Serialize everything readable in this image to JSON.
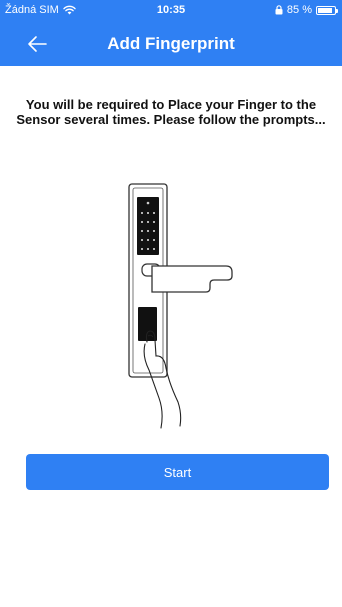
{
  "status_bar": {
    "carrier": "Žádná SIM",
    "time": "10:35",
    "battery_percent_label": "85 %",
    "battery_level": 0.85,
    "icons": [
      "wifi-icon",
      "lock-icon",
      "battery-icon"
    ]
  },
  "nav": {
    "title": "Add Fingerprint",
    "back_icon": "arrow-left-icon"
  },
  "main": {
    "instructions": "You will be required to Place your Finger to the Sensor several times. Please follow the prompts...",
    "illustration": "door-lock-fingerprint-illustration",
    "start_label": "Start"
  },
  "colors": {
    "primary": "#2f80f3",
    "background": "#ffffff",
    "text": "#111111"
  }
}
